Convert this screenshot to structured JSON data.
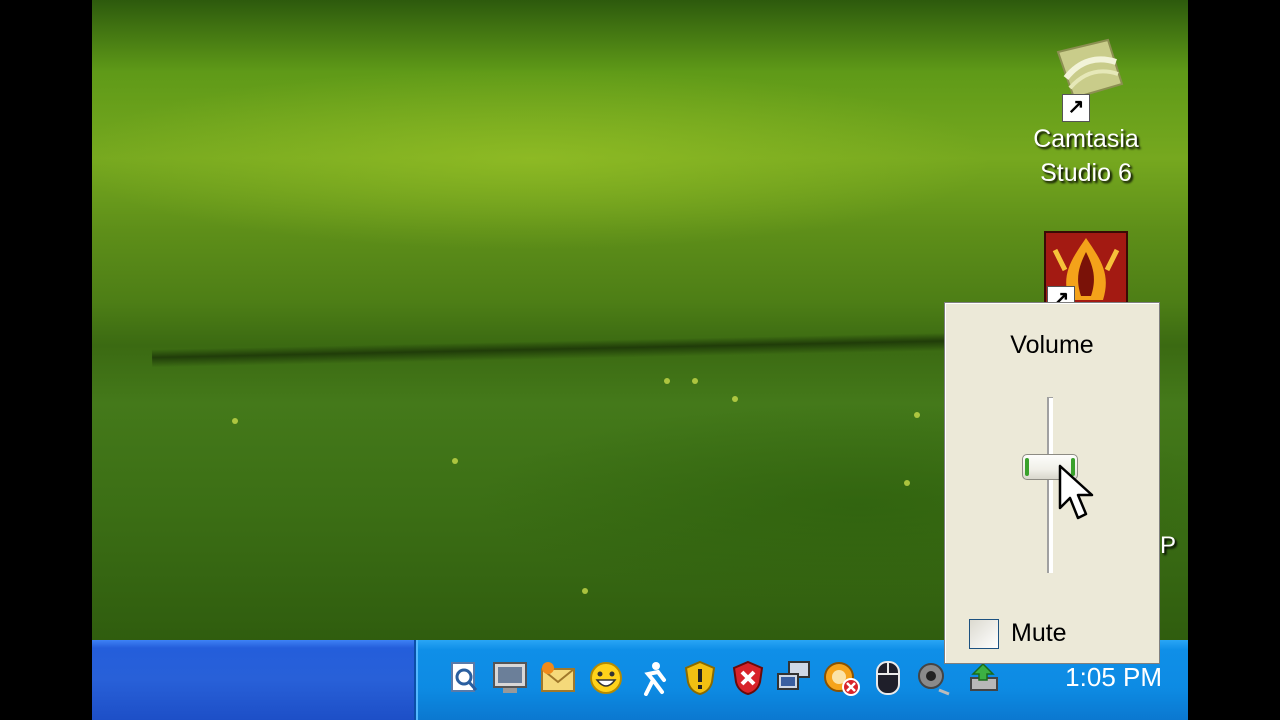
{
  "desktop": {
    "icons": [
      {
        "label": "Camtasia Studio 6",
        "icon": "camtasia-icon"
      },
      {
        "label": "",
        "icon": "game-shortcut-icon"
      }
    ],
    "partial_label": "P"
  },
  "volume_popup": {
    "title": "Volume",
    "level_fraction": 0.62,
    "mute_label": "Mute",
    "mute_checked": false
  },
  "taskbar": {
    "tray_icons": [
      "search-doc-icon",
      "monitor-icon",
      "mail-icon",
      "smiley-messenger-icon",
      "aim-runner-icon",
      "security-shield-icon",
      "antivirus-shield-icon",
      "network-icon",
      "connection-error-icon",
      "mouse-icon",
      "webcam-icon",
      "safely-remove-icon"
    ],
    "clock": "1:05 PM"
  },
  "colors": {
    "taskbar_blue": "#245edb",
    "tray_blue": "#0f8fe8",
    "popup_bg": "#ece9d8",
    "slider_green": "#3aa12c"
  }
}
